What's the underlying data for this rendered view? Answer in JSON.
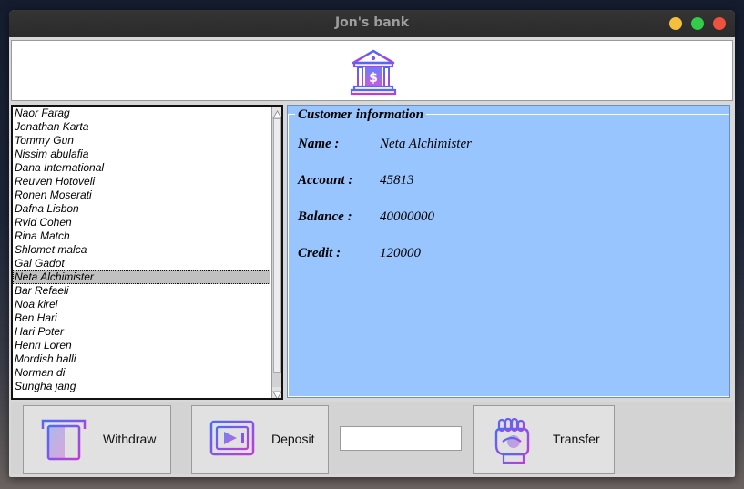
{
  "window": {
    "title": "Jon's bank"
  },
  "customers": [
    "Naor Farag",
    "Jonathan Karta",
    "Tommy Gun",
    "Nissim abulafia",
    "Dana International",
    "Reuven Hotoveli",
    "Ronen Moserati",
    "Dafna Lisbon",
    "Rvid Cohen",
    "Rina Match",
    "Shlomet malca",
    "Gal Gadot",
    "Neta Alchimister",
    "Bar Refaeli",
    "Noa kirel",
    "Ben Hari",
    "Hari Poter",
    "Henri Loren",
    "Mordish halli",
    "Norman di",
    "Sungha jang"
  ],
  "selected_customer": "Neta Alchimister",
  "info": {
    "title": "Customer information",
    "name_label": "Name :",
    "name": "Neta Alchimister",
    "account_label": "Account :",
    "account": "45813",
    "balance_label": "Balance :",
    "balance": "40000000",
    "credit_label": "Credit :",
    "credit": "120000"
  },
  "actions": {
    "withdraw_label": "Withdraw",
    "deposit_label": "Deposit",
    "transfer_label": "Transfer",
    "amount_value": ""
  },
  "colors": {
    "info_panel_bg": "#99c5ff",
    "icon_gradient_start": "#4a6cf7",
    "icon_gradient_end": "#c23bd6"
  },
  "icons": {
    "header": "bank-icon",
    "withdraw": "atm-card-icon",
    "deposit": "safe-icon",
    "transfer": "hand-coin-icon"
  }
}
